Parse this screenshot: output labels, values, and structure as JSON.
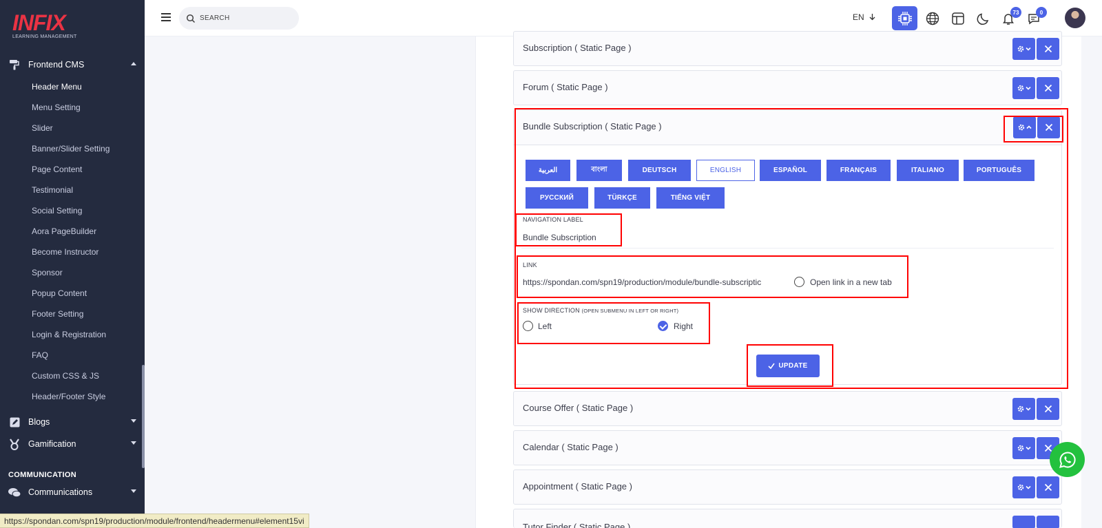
{
  "brand": {
    "logo_text": "INFIX",
    "logo_sub": "LEARNING MANAGEMENT"
  },
  "sidebar": {
    "frontend_cms": "Frontend CMS",
    "sub_items": [
      "Header Menu",
      "Menu Setting",
      "Slider",
      "Banner/Slider Setting",
      "Page Content",
      "Testimonial",
      "Social Setting",
      "Aora PageBuilder",
      "Become Instructor",
      "Sponsor",
      "Popup Content",
      "Footer Setting",
      "Login & Registration",
      "FAQ",
      "Custom CSS & JS",
      "Header/Footer Style"
    ],
    "blogs": "Blogs",
    "gamification": "Gamification",
    "section_communication": "COMMUNICATION",
    "communications": "Communications"
  },
  "topbar": {
    "search_placeholder": "SEARCH",
    "language": "EN",
    "notification_count": "73",
    "message_count": "0"
  },
  "menu_items": {
    "subscription": "Subscription ( Static Page )",
    "forum": "Forum ( Static Page )",
    "bundle_subscription": "Bundle Subscription ( Static Page )",
    "course_offer": "Course Offer ( Static Page )",
    "calendar": "Calendar ( Static Page )",
    "appointment": "Appointment ( Static Page )",
    "tutor_finder": "Tutor Finder ( Static Page )"
  },
  "languages": [
    "العربية",
    "বাংলা",
    "DEUTSCH",
    "ENGLISH",
    "ESPAÑOL",
    "FRANÇAIS",
    "ITALIANO",
    "PORTUGUÊS",
    "РУССКИЙ",
    "TÜRKÇE",
    "TIẾNG VIỆT"
  ],
  "selected_language": "ENGLISH",
  "form": {
    "nav_label_title": "NAVIGATION LABEL",
    "nav_label_value": "Bundle Subscription",
    "link_title": "LINK",
    "link_value": "https://spondan.com/spn19/production/module/bundle-subscriptic",
    "new_tab_label": "Open link in a new tab",
    "direction_title": "SHOW DIRECTION",
    "direction_hint": "(OPEN SUBMENU IN LEFT OR RIGHT)",
    "left_label": "Left",
    "right_label": "Right",
    "selected_direction": "Right",
    "update_label": "UPDATE"
  },
  "status_url": "https://spondan.com/spn19/production/module/frontend/headermenu#element15vi",
  "colors": {
    "accent": "#4c63e6",
    "sidebar_bg": "#242b3f",
    "highlight": "#ff0000",
    "whatsapp": "#23c13e"
  }
}
